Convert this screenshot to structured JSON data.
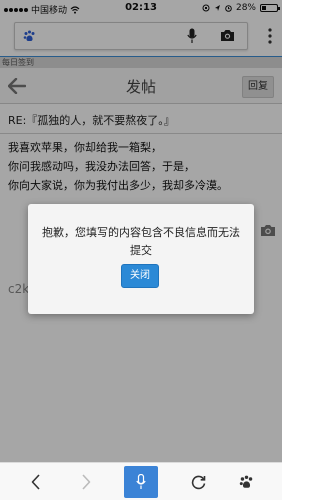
{
  "status_bar": {
    "carrier": "中国移动",
    "time": "02:13",
    "battery": "28%",
    "battery_level": 0.28
  },
  "browser": {
    "search_placeholder": "",
    "icons": [
      "baidu-paw-icon",
      "microphone-icon",
      "camera-icon",
      "more-vertical-icon"
    ]
  },
  "page": {
    "daily_sign": "每日签到",
    "title": "发帖",
    "reply_label": "回复"
  },
  "post": {
    "subject": "RE:『孤独的人，就不要熬夜了。』",
    "body_lines": [
      "我喜欢苹果，你却给我一箱梨，",
      "你问我感动吗，我没办法回答，于是，",
      "你向大家说，你为我付出多少，我却多冷漠。"
    ],
    "partial_text": "c2k"
  },
  "modal": {
    "message": "抱歉，您填写的内容包含不良信息而无法提交",
    "close_label": "关闭"
  },
  "bottom_bar": {
    "icons": [
      "back-icon",
      "forward-icon",
      "voice-icon",
      "refresh-icon",
      "baidu-paw-icon"
    ]
  },
  "colors": {
    "accent": "#2b89d6",
    "header_bg": "#f7f7f7",
    "overlay": "rgba(0,0,0,0.35)"
  }
}
